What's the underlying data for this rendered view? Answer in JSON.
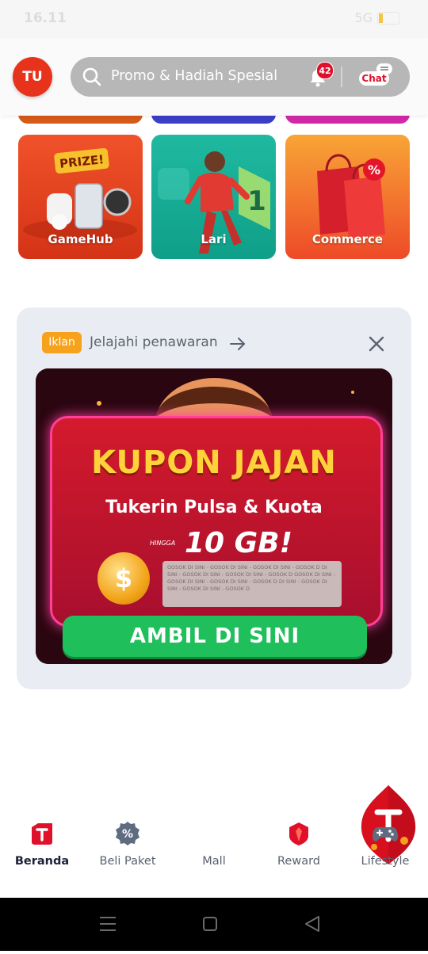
{
  "status": {
    "time": "16.11",
    "network": "5G"
  },
  "header": {
    "avatar_initials": "TU",
    "search_text": "Promo & Hadiah Spesial",
    "notification_count": "42",
    "chat_label": "Chat"
  },
  "tiles": [
    {
      "label": "GameHub"
    },
    {
      "label": "Lari"
    },
    {
      "label": "Commerce"
    }
  ],
  "ad": {
    "badge": "Iklan",
    "explore_label": "Jelajahi penawaran",
    "banner": {
      "title": "KUPON JAJAN",
      "subtitle": "Tukerin Pulsa & Kuota",
      "upto": "HINGGA",
      "amount": "10 GB!",
      "scratch_text": "GOSOK DI SINI - GOSOK DI SINI - GOSOK DI SINI - GOSOK D DI SINI - GOSOK DI SINI - GOSOK DI SINI - GOSOK D GOSOK DI SINI - GOSOK DI SINI - GOSOK DI SINI - GOSOK D DI SINI - GOSOK DI SINI - GOSOK DI SINI - GOSOK D",
      "cta": "AMBIL DI SINI"
    }
  },
  "bottom_nav": [
    {
      "label": "Beranda",
      "icon": "home-icon",
      "active": true
    },
    {
      "label": "Beli Paket",
      "icon": "discount-icon"
    },
    {
      "label": "Mall",
      "icon": "mall-logo"
    },
    {
      "label": "Reward",
      "icon": "reward-icon"
    },
    {
      "label": "Lifestyle",
      "icon": "gamepad-icon"
    }
  ],
  "colors": {
    "brand_red": "#e0102a",
    "active_nav": "#1a2138",
    "cta_green": "#1fbf5b"
  }
}
